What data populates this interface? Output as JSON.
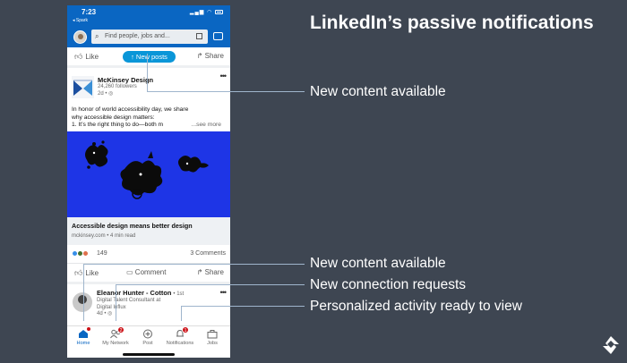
{
  "headline": "LinkedIn’s passive notifications",
  "callouts": [
    "New content available",
    "New content available",
    "New connection requests",
    "Personalized activity ready to view"
  ],
  "status_bar": {
    "time": "7:23",
    "back_label": "◂ Spark"
  },
  "search": {
    "placeholder": "Find people, jobs and..."
  },
  "top_actions": {
    "like": "Like",
    "new_posts": "New posts",
    "share": "Share"
  },
  "post1": {
    "author": "McKinsey Design",
    "followers": "24,260 followers",
    "age": "2d •",
    "text_line1": "In honor of world accessibility day, we share",
    "text_line2": "why accessible design matters:",
    "text_line3": "1. It’s the right thing to do—both m",
    "see_more": "...see more",
    "link_title": "Accessible design means better design",
    "link_source": "mckinsey.com • 4 min read",
    "reactions_count": "149",
    "comments_count": "3 Comments"
  },
  "post_actions": {
    "like": "Like",
    "comment": "Comment",
    "share": "Share"
  },
  "post2": {
    "author": "Eleanor Hunter - Cotton",
    "degree": "• 1st",
    "headline_line1": "Digital Talent Consultant at",
    "headline_line2": "Digital Influx",
    "age": "4d •"
  },
  "tabs": [
    {
      "label": "Home",
      "badge": "",
      "icon": "home-icon",
      "active": true
    },
    {
      "label": "My Network",
      "badge": "2",
      "icon": "network-icon",
      "active": false
    },
    {
      "label": "Post",
      "badge": "",
      "icon": "post-icon",
      "active": false
    },
    {
      "label": "Notifications",
      "badge": "1",
      "icon": "bell-icon",
      "active": false
    },
    {
      "label": "Jobs",
      "badge": "",
      "icon": "briefcase-icon",
      "active": false
    }
  ],
  "colors": {
    "background": "#3e4652",
    "linkedin_blue": "#0a66c2",
    "new_posts_pill": "#0a96d8",
    "badge_red": "#cc1016",
    "image_blue": "#1e35e6",
    "callout_line": "#9fb5cc"
  }
}
